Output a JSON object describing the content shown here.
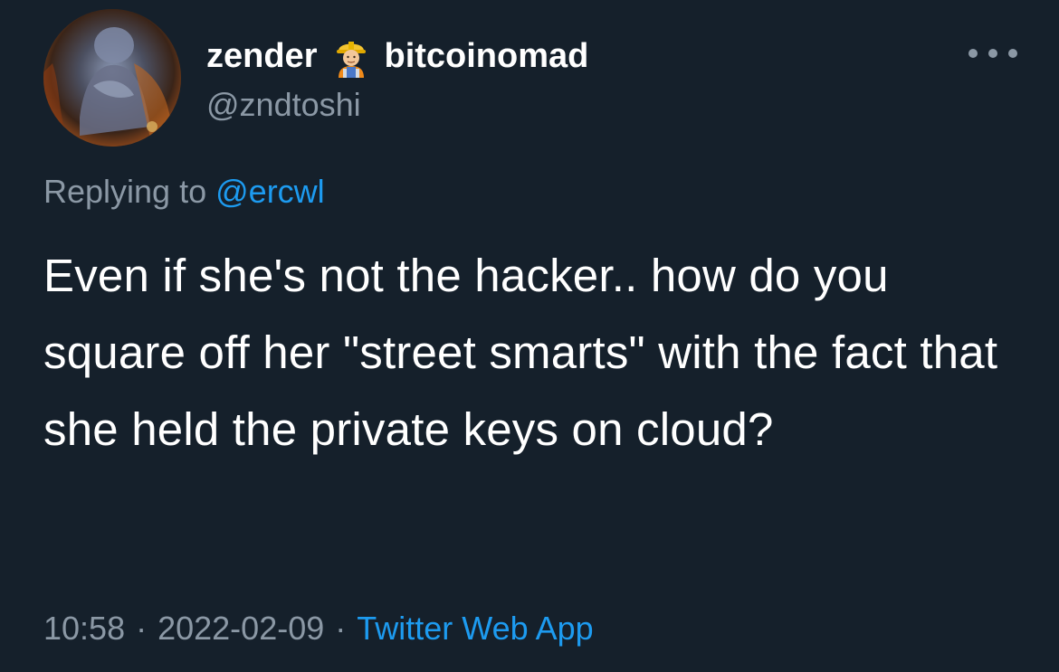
{
  "tweet": {
    "display_name": "zender",
    "display_name_suffix": "bitcoinomad",
    "emoji_icon": "construction-worker-emoji",
    "handle": "@zndtoshi",
    "replying_prefix": "Replying to",
    "replying_to": "@ercwl",
    "text": "Even if she's not the hacker.. how do you square off her \"street smarts\" with the fact that she held the private keys on cloud?",
    "time": "10:58",
    "separator": "·",
    "date": "2022-02-09",
    "source": "Twitter Web App"
  },
  "colors": {
    "background": "#15202b",
    "text": "#ffffff",
    "muted": "#8b98a5",
    "accent": "#1d9bf0"
  },
  "icons": {
    "more": "more-horizontal-icon"
  }
}
